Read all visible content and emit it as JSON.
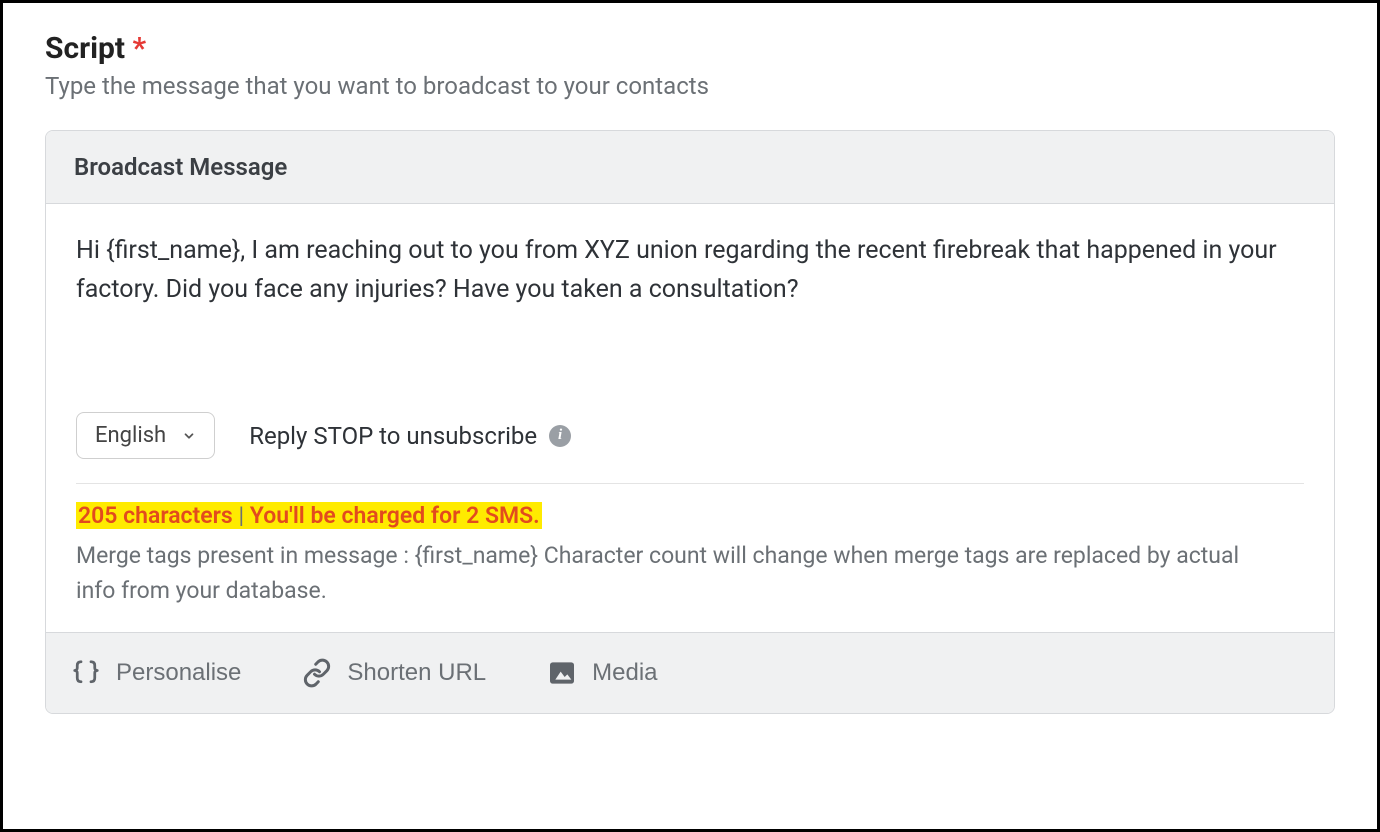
{
  "section": {
    "title": "Script",
    "required_marker": "*",
    "subtitle": "Type the message that you want to broadcast to your contacts"
  },
  "card": {
    "header": "Broadcast Message",
    "message": "Hi {first_name}, I am reaching out to you from XYZ union regarding the recent firebreak that happened in your factory. Did you face any injuries? Have you taken a consultation?",
    "language": "English",
    "unsubscribe_hint": "Reply STOP to unsubscribe"
  },
  "count": {
    "characters_label": "205 characters",
    "separator": " | ",
    "charge_label": "You'll be charged for 2 SMS.",
    "merge_note": "Merge tags present in message : {first_name} Character count will change when merge tags are replaced by actual info from your database."
  },
  "footer": {
    "personalise": "Personalise",
    "shorten_url": "Shorten URL",
    "media": "Media"
  }
}
